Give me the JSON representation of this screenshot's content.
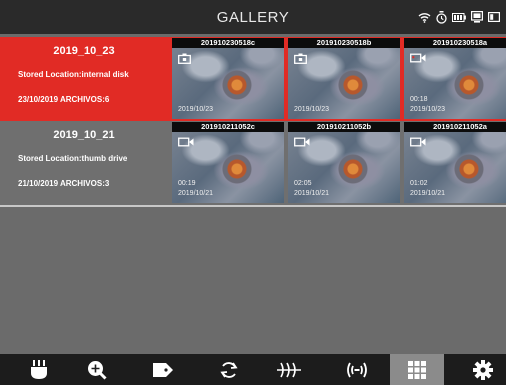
{
  "header": {
    "title": "GALLERY",
    "status_icons": [
      "wifi-icon",
      "timer-icon",
      "battery-icon",
      "storage-icon",
      "card-icon"
    ]
  },
  "rows": [
    {
      "date": "2019_10_23",
      "location": "Stored Location:internal disk",
      "files": "23/10/2019 ARCHIVOS:6",
      "thumbs": [
        {
          "name": "201910230518c",
          "icon": "snapshot-icon",
          "duration": "",
          "date": "2019/10/23"
        },
        {
          "name": "201910230518b",
          "icon": "snapshot-icon",
          "duration": "",
          "date": "2019/10/23"
        },
        {
          "name": "201910230518a",
          "icon": "video-icon",
          "duration": "00:18",
          "date": "2019/10/23"
        }
      ]
    },
    {
      "date": "2019_10_21",
      "location": "Stored Location:thumb drive",
      "files": "21/10/2019 ARCHIVOS:3",
      "thumbs": [
        {
          "name": "201910211052c",
          "icon": "video-icon",
          "duration": "00:19",
          "date": "2019/10/21"
        },
        {
          "name": "201910211052b",
          "icon": "video-icon",
          "duration": "02:05",
          "date": "2019/10/21"
        },
        {
          "name": "201910211052a",
          "icon": "video-icon",
          "duration": "01:02",
          "date": "2019/10/21"
        }
      ]
    }
  ],
  "toolbar": {
    "buttons": [
      "light-icon",
      "zoom-in-icon",
      "tag-icon",
      "rotate-icon",
      "filter-icon",
      "signal-icon",
      "grid-icon",
      "settings-icon"
    ],
    "active": "grid-icon"
  },
  "colors": {
    "selected_row": "#e12b25",
    "row": "#6f6f6f",
    "background": "#6b6b6b",
    "header": "#2a2a2a",
    "toolbar": "#1c1c1c"
  }
}
